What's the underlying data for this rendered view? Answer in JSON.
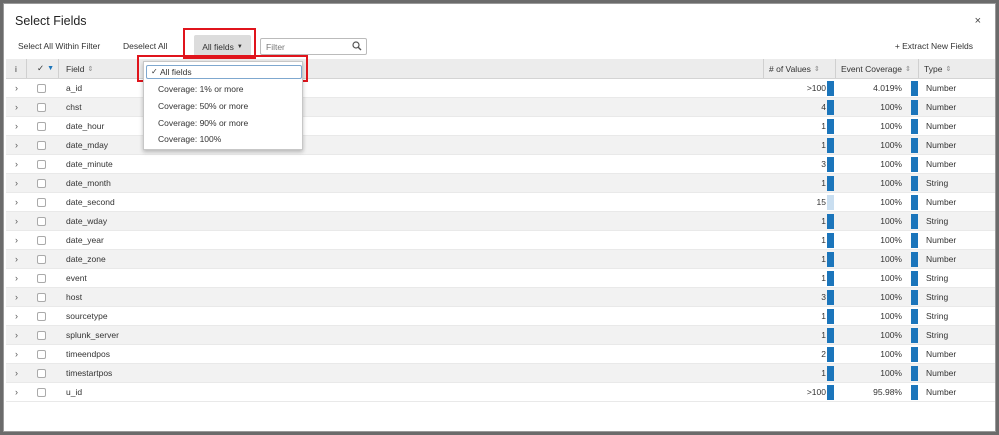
{
  "modal": {
    "title": "Select Fields",
    "close": "×"
  },
  "toolbar": {
    "select_all_within_filter": "Select All Within Filter",
    "deselect_all": "Deselect All",
    "all_fields": "All fields",
    "filter_placeholder": "Filter",
    "extract_new_fields": "+ Extract New Fields"
  },
  "dropdown": {
    "selected_check": "✓",
    "items": [
      "All fields",
      "Coverage: 1% or more",
      "Coverage: 50% or more",
      "Coverage: 90% or more",
      "Coverage: 100%"
    ],
    "selected_index": 0
  },
  "table": {
    "headers": {
      "info": "i",
      "check": "✓",
      "field": "Field",
      "num_values": "# of Values",
      "event_coverage": "Event Coverage",
      "type": "Type"
    },
    "rows": [
      {
        "field": "a_id",
        "num_values": ">100",
        "coverage": "4.019%",
        "type": "Number"
      },
      {
        "field": "chst",
        "num_values": "4",
        "coverage": "100%",
        "type": "Number"
      },
      {
        "field": "date_hour",
        "num_values": "1",
        "coverage": "100%",
        "type": "Number"
      },
      {
        "field": "date_mday",
        "num_values": "1",
        "coverage": "100%",
        "type": "Number"
      },
      {
        "field": "date_minute",
        "num_values": "3",
        "coverage": "100%",
        "type": "Number"
      },
      {
        "field": "date_month",
        "num_values": "1",
        "coverage": "100%",
        "type": "String"
      },
      {
        "field": "date_second",
        "num_values": "15",
        "coverage": "100%",
        "type": "Number"
      },
      {
        "field": "date_wday",
        "num_values": "1",
        "coverage": "100%",
        "type": "String"
      },
      {
        "field": "date_year",
        "num_values": "1",
        "coverage": "100%",
        "type": "Number"
      },
      {
        "field": "date_zone",
        "num_values": "1",
        "coverage": "100%",
        "type": "Number"
      },
      {
        "field": "event",
        "num_values": "1",
        "coverage": "100%",
        "type": "String"
      },
      {
        "field": "host",
        "num_values": "3",
        "coverage": "100%",
        "type": "String"
      },
      {
        "field": "sourcetype",
        "num_values": "1",
        "coverage": "100%",
        "type": "String"
      },
      {
        "field": "splunk_server",
        "num_values": "1",
        "coverage": "100%",
        "type": "String"
      },
      {
        "field": "timeendpos",
        "num_values": "2",
        "coverage": "100%",
        "type": "Number"
      },
      {
        "field": "timestartpos",
        "num_values": "1",
        "coverage": "100%",
        "type": "Number"
      },
      {
        "field": "u_id",
        "num_values": ">100",
        "coverage": "95.98%",
        "type": "Number"
      }
    ]
  },
  "colors": {
    "bar_dark": "#1b75bb",
    "bar_light": "#c9def0",
    "highlight": "#e0141c"
  }
}
